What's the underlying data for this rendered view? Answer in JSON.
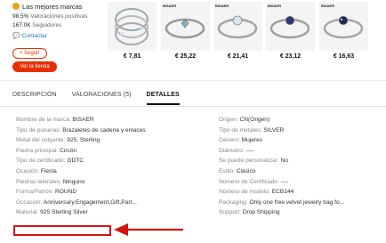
{
  "store": {
    "name": "Las mejores marcas",
    "rating_value": "98.5%",
    "rating_label": "Valoraciones positivas",
    "followers_value": "167.0K",
    "followers_label": "Seguidores",
    "contact_label": "Contactar",
    "follow_label": "+ Seguir",
    "visit_label": "Ver la tienda"
  },
  "products": [
    {
      "price": "€ 7,81",
      "brand": ""
    },
    {
      "price": "€ 25,22",
      "brand": "BISAER"
    },
    {
      "price": "€ 21,41",
      "brand": "BISAER"
    },
    {
      "price": "€ 23,12",
      "brand": "BISAER"
    },
    {
      "price": "€ 16,63",
      "brand": "BISAER"
    }
  ],
  "tabs": [
    {
      "label": "DESCRIPCIÓN",
      "active": false
    },
    {
      "label": "VALORACIONES (5)",
      "active": false
    },
    {
      "label": "DETALLES",
      "active": true
    }
  ],
  "specs_left": [
    {
      "k": "Nombre de la marca:",
      "v": "BISAER"
    },
    {
      "k": "Tipo de pulseras:",
      "v": "Brazaletes de cadena y enlaces"
    },
    {
      "k": "Metal del colgante:",
      "v": "925, Sterling"
    },
    {
      "k": "Piedra principal:",
      "v": "Circón"
    },
    {
      "k": "Tipo de certificado:",
      "v": "GDTC"
    },
    {
      "k": "Ocasión:",
      "v": "Fiesta"
    },
    {
      "k": "Piedras laterales:",
      "v": "Ninguno"
    },
    {
      "k": "Forma/Patrón:",
      "v": "ROUND"
    },
    {
      "k": "Occasion:",
      "v": "Anniversary,Engagement,Gift,Part..."
    },
    {
      "k": "Material:",
      "v": "925 Sterling Silver"
    }
  ],
  "specs_right": [
    {
      "k": "Origen:",
      "v": "CN(Origen)"
    },
    {
      "k": "Tipo de metales:",
      "v": "SILVER"
    },
    {
      "k": "Género:",
      "v": "Mujeres"
    },
    {
      "k": "Diámetro:",
      "v": "----"
    },
    {
      "k": "Se puede personalizar:",
      "v": "No"
    },
    {
      "k": "Estilo:",
      "v": "Clásico"
    },
    {
      "k": "Número de Certificado:",
      "v": "----"
    },
    {
      "k": "Número de modelo:",
      "v": "ECB144"
    },
    {
      "k": "Packaging:",
      "v": "Only one free velvet jewelry bag fo..."
    },
    {
      "k": "Support:",
      "v": "Drop Shipping"
    }
  ],
  "colors": {
    "accent": "#e62e04",
    "link": "#1a73c8",
    "highlight": "#d21515"
  }
}
